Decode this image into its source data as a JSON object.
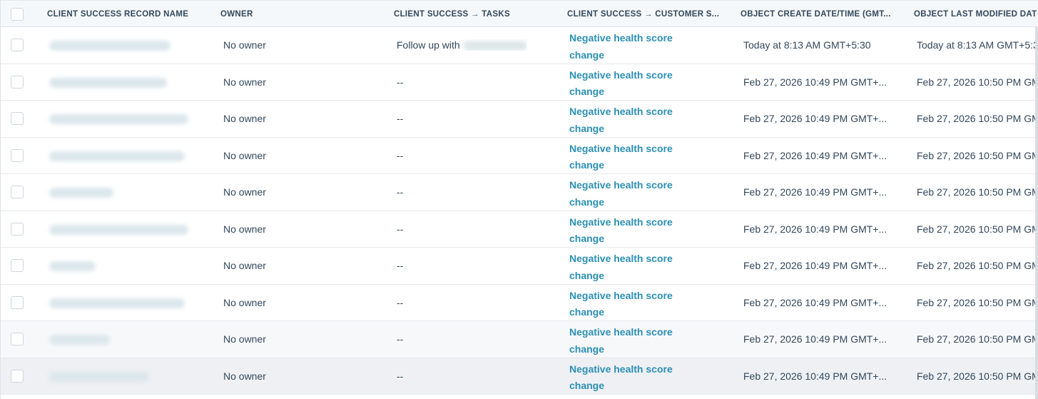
{
  "table": {
    "columns": [
      "CLIENT SUCCESS RECORD NAME",
      "OWNER",
      "CLIENT SUCCESS → TASKS",
      "CLIENT SUCCESS → CUSTOMER S...",
      "OBJECT CREATE DATE/TIME (GMT...",
      "OBJECT LAST MODIFIED DAT"
    ],
    "rows": [
      {
        "owner": "No owner",
        "tasks": "Follow up with",
        "status_line1": "Negative health score",
        "status_line2": "change",
        "created": "Today at 8:13 AM GMT+5:30",
        "modified": "Today at 8:13 AM GMT+5:3"
      },
      {
        "owner": "No owner",
        "tasks": "--",
        "status_line1": "Negative health score",
        "status_line2": "change",
        "created": "Feb 27, 2026 10:49 PM GMT+...",
        "modified": "Feb 27, 2026 10:50 PM GM"
      },
      {
        "owner": "No owner",
        "tasks": "--",
        "status_line1": "Negative health score",
        "status_line2": "change",
        "created": "Feb 27, 2026 10:49 PM GMT+...",
        "modified": "Feb 27, 2026 10:50 PM GM"
      },
      {
        "owner": "No owner",
        "tasks": "--",
        "status_line1": "Negative health score",
        "status_line2": "change",
        "created": "Feb 27, 2026 10:49 PM GMT+...",
        "modified": "Feb 27, 2026 10:50 PM GM"
      },
      {
        "owner": "No owner",
        "tasks": "--",
        "status_line1": "Negative health score",
        "status_line2": "change",
        "created": "Feb 27, 2026 10:49 PM GMT+...",
        "modified": "Feb 27, 2026 10:50 PM GM"
      },
      {
        "owner": "No owner",
        "tasks": "--",
        "status_line1": "Negative health score",
        "status_line2": "change",
        "created": "Feb 27, 2026 10:49 PM GMT+...",
        "modified": "Feb 27, 2026 10:50 PM GM"
      },
      {
        "owner": "No owner",
        "tasks": "--",
        "status_line1": "Negative health score",
        "status_line2": "change",
        "created": "Feb 27, 2026 10:49 PM GMT+...",
        "modified": "Feb 27, 2026 10:50 PM GM"
      },
      {
        "owner": "No owner",
        "tasks": "--",
        "status_line1": "Negative health score",
        "status_line2": "change",
        "created": "Feb 27, 2026 10:49 PM GMT+...",
        "modified": "Feb 27, 2026 10:50 PM GM"
      },
      {
        "owner": "No owner",
        "tasks": "--",
        "status_line1": "Negative health score",
        "status_line2": "change",
        "created": "Feb 27, 2026 10:49 PM GMT+...",
        "modified": "Feb 27, 2026 10:50 PM GM"
      },
      {
        "owner": "No owner",
        "tasks": "--",
        "status_line1": "Negative health score",
        "status_line2": "change",
        "created": "Feb 27, 2026 10:49 PM GMT+...",
        "modified": "Feb 27, 2026 10:50 PM GM"
      }
    ]
  },
  "colors": {
    "link": "#2b8fb3",
    "text": "#33475b",
    "header_bg": "#f5f8fa",
    "border": "#dfe3eb"
  }
}
